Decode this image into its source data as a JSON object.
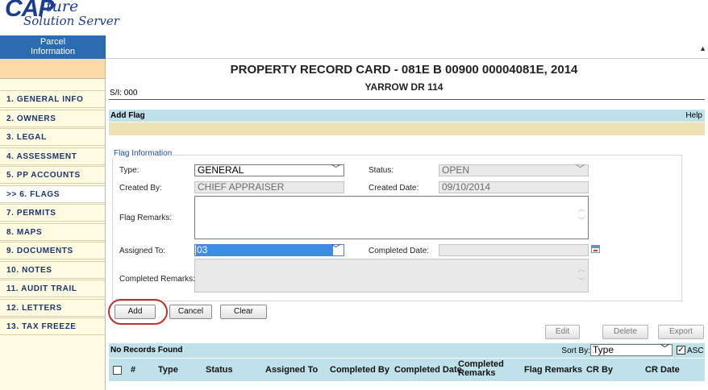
{
  "logo": {
    "cap": "CAP",
    "ture": "ture",
    "sub": "Solution Server"
  },
  "top_tab": {
    "line1": "Parcel",
    "line2": "Information"
  },
  "sidebar": {
    "items": [
      {
        "label": "1. GENERAL INFO"
      },
      {
        "label": "2. OWNERS"
      },
      {
        "label": "3. LEGAL"
      },
      {
        "label": "4. ASSESSMENT"
      },
      {
        "label": "5. PP ACCOUNTS"
      },
      {
        "label": ">> 6. FLAGS"
      },
      {
        "label": "7. PERMITS"
      },
      {
        "label": "8. MAPS"
      },
      {
        "label": "9. DOCUMENTS"
      },
      {
        "label": "10. NOTES"
      },
      {
        "label": "11. AUDIT TRAIL"
      },
      {
        "label": "12. LETTERS"
      },
      {
        "label": "13. TAX FREEZE"
      }
    ]
  },
  "header": {
    "title": "PROPERTY RECORD CARD - 081E B 00900 00004081E, 2014",
    "subtitle": "YARROW DR 114",
    "si": "S/I: 000"
  },
  "add_flag_bar": {
    "label": "Add Flag",
    "help": "Help"
  },
  "form": {
    "legend": "Flag Information",
    "type_label": "Type:",
    "type_value": "GENERAL",
    "status_label": "Status:",
    "status_value": "OPEN",
    "created_by_label": "Created By:",
    "created_by_value": "CHIEF APPRAISER",
    "created_date_label": "Created Date:",
    "created_date_value": "09/10/2014",
    "flag_remarks_label": "Flag Remarks:",
    "assigned_to_label": "Assigned To:",
    "assigned_to_value": "03",
    "completed_date_label": "Completed Date:",
    "completed_remarks_label": "Completed Remarks:"
  },
  "buttons": {
    "add": "Add",
    "cancel": "Cancel",
    "clear": "Clear",
    "edit": "Edit",
    "delete": "Delete",
    "export": "Export"
  },
  "records": {
    "label": "No Records Found",
    "sort_by_label": "Sort By:",
    "sort_by_value": "Type",
    "asc_label": "ASC",
    "columns": {
      "num": "#",
      "type": "Type",
      "status": "Status",
      "assigned_to": "Assigned To",
      "completed_by": "Completed By",
      "completed_date": "Completed Date",
      "completed_remarks_1": "Completed",
      "completed_remarks_2": "Remarks",
      "flag_remarks": "Flag Remarks",
      "cr_by": "CR By",
      "cr_date": "CR Date"
    }
  },
  "colors": {
    "sidebar_bg": "#fefbe0",
    "tab_blue": "#2b6cb0",
    "bar_blue": "#bfe1ea",
    "bar_tan": "#ece2b4",
    "highlight": "#c03030"
  }
}
